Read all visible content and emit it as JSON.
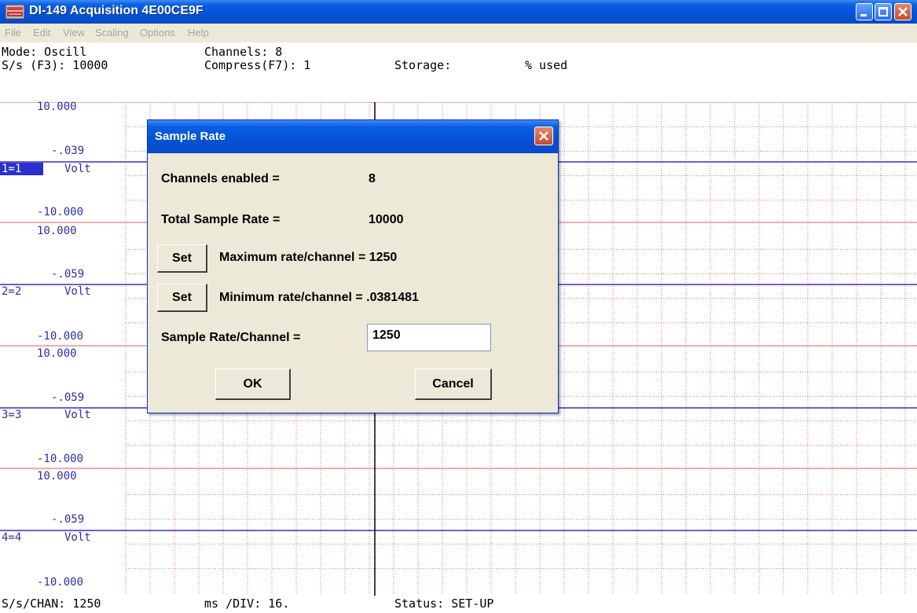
{
  "window": {
    "title": "DI-149 Acquisition 4E00CE9F",
    "minimize_icon": "minimize-icon",
    "maximize_icon": "maximize-icon",
    "close_icon": "close-icon"
  },
  "menu": {
    "items": [
      "File",
      "Edit",
      "View",
      "Scaling",
      "Options",
      "Help"
    ]
  },
  "info": {
    "mode": "Mode: Oscill",
    "channels": "Channels: 8",
    "sample_rate": "S/s (F3): 10000",
    "compress": "Compress(F7): 1",
    "storage": "Storage:",
    "used": "% used"
  },
  "channels": [
    {
      "id": "1=1",
      "max": "10.000",
      "mid": "-.039",
      "unit": "Volt",
      "min": "-10.000",
      "selected": true
    },
    {
      "id": "2=2",
      "max": "10.000",
      "mid": "-.059",
      "unit": "Volt",
      "min": "-10.000",
      "selected": false
    },
    {
      "id": "3=3",
      "max": "10.000",
      "mid": "-.059",
      "unit": "Volt",
      "min": "-10.000",
      "selected": false
    },
    {
      "id": "4=4",
      "max": "10.000",
      "mid": "-.059",
      "unit": "Volt",
      "min": "-10.000",
      "selected": false
    }
  ],
  "status": {
    "chan_rate": "S/s/CHAN: 1250",
    "ms_div": "ms /DIV: 16.",
    "status": "Status: SET-UP"
  },
  "dialog": {
    "title": "Sample Rate",
    "channels_enabled_label": "Channels enabled =",
    "channels_enabled_value": "8",
    "total_rate_label": "Total Sample Rate =",
    "total_rate_value": "10000",
    "set_label": "Set",
    "max_rate_text": "Maximum rate/channel = 1250",
    "min_rate_text": "Minimum rate/channel = .0381481",
    "rate_per_channel_label": "Sample Rate/Channel =",
    "rate_per_channel_value": "1250",
    "ok_label": "OK",
    "cancel_label": "Cancel"
  },
  "colors": {
    "grid": "#e85a5a",
    "grid_dotted": "#e07070",
    "trace": "#3a2fc0",
    "cursor": "#000000",
    "label": "#2c2fa8",
    "titlebar": "#0552d6",
    "dialog_bg": "#ece9d8"
  }
}
